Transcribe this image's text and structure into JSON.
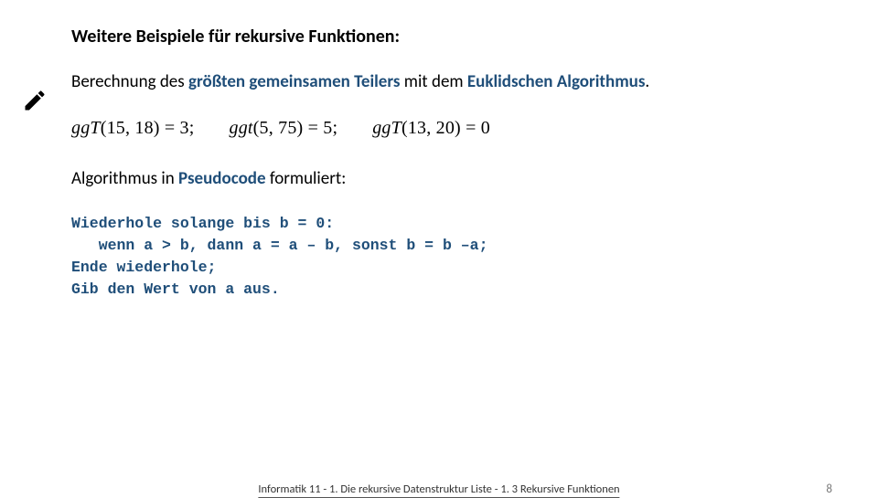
{
  "title": "Weitere Beispiele für rekursive Funktionen:",
  "line1": {
    "pre": "Berechnung des ",
    "bold1": "größten gemeinsamen Teilers",
    "mid": " mit dem ",
    "bold2": "Euklidschen Algorithmus",
    "end": "."
  },
  "equations": {
    "eq1_fn": "ggT",
    "eq1_args": "(15, 18) = 3;",
    "eq2_fn": "ggt",
    "eq2_args": "(5, 75) = 5;",
    "eq3_fn": "ggT",
    "eq3_args": "(13, 20) = 0"
  },
  "line2": {
    "pre": "Algorithmus in ",
    "bold": "Pseudocode",
    "post": " formuliert:"
  },
  "pseudocode": "Wiederhole solange bis b = 0:\n   wenn a > b, dann a = a – b, sonst b = b –a;\nEnde wiederhole;\nGib den Wert von a aus.",
  "footer": {
    "center": "Informatik 11 - 1. Die rekursive Datenstruktur Liste - 1. 3 Rekursive Funktionen",
    "page": "8"
  },
  "icon_name": "pencil-icon"
}
